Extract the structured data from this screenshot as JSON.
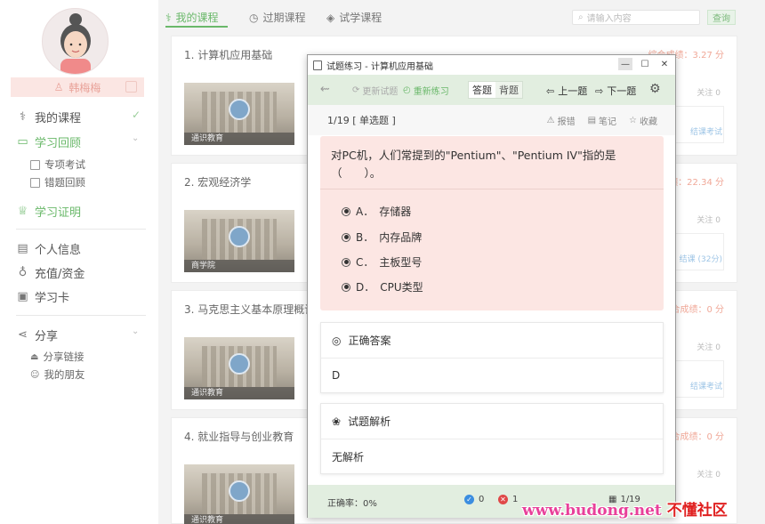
{
  "sidebar": {
    "username": "韩梅梅",
    "nav": [
      {
        "label": "我的课程",
        "icon": "book-icon"
      },
      {
        "label": "学习回顾",
        "icon": "monitor-icon"
      },
      {
        "label": "学习证明",
        "icon": "certificate-icon"
      },
      {
        "label": "个人信息",
        "icon": "id-card-icon"
      },
      {
        "label": "充值/资金",
        "icon": "money-bag-icon"
      },
      {
        "label": "学习卡",
        "icon": "card-icon"
      },
      {
        "label": "分享",
        "icon": "share-icon"
      }
    ],
    "review_sub": [
      "专项考试",
      "错题回顾"
    ],
    "share_sub": [
      "分享链接",
      "我的朋友"
    ]
  },
  "tabs": [
    {
      "label": "我的课程"
    },
    {
      "label": "过期课程"
    },
    {
      "label": "试学课程"
    }
  ],
  "search": {
    "placeholder": "请输入内容",
    "button": "查询"
  },
  "courses": [
    {
      "title": "1. 计算机应用基础",
      "score": "综合成绩：3.27 分",
      "caption": "通识教育",
      "follow": "关注 0",
      "exam": "结课考试"
    },
    {
      "title": "2. 宏观经济学",
      "score": "绩：22.34 分",
      "caption": "商学院",
      "follow": "关注 0",
      "exam": "结课 (32分)"
    },
    {
      "title": "3. 马克思主义基本原理概论",
      "score": "合成绩：0 分",
      "caption": "通识教育",
      "follow": "关注 0",
      "exam": "结课考试"
    },
    {
      "title": "4. 就业指导与创业教育",
      "score": "合成绩：0 分",
      "caption": "通识教育",
      "follow": "关注 0",
      "exam": ""
    }
  ],
  "popup": {
    "title": "试题练习 - 计算机应用基础",
    "toolbar": {
      "update": "更新试题",
      "redo": "重新练习",
      "answer_mode": "答题",
      "memorize_mode": "背题",
      "prev": "上一题",
      "next": "下一题"
    },
    "question_index": "1/19 [ 单选题 ]",
    "tools": [
      "报错",
      "笔记",
      "收藏"
    ],
    "question": "对PC机，人们常提到的\"Pentium\"、\"Pentium IV\"指的是（　　）。",
    "options": [
      {
        "key": "A．",
        "text": "存储器"
      },
      {
        "key": "B．",
        "text": "内存品牌"
      },
      {
        "key": "C．",
        "text": "主板型号"
      },
      {
        "key": "D．",
        "text": "CPU类型"
      }
    ],
    "answer_title": "正确答案",
    "answer": "D",
    "analysis_title": "试题解析",
    "analysis": "无解析",
    "status": {
      "rate": "正确率：0%",
      "correct": "0",
      "wrong": "1",
      "page": "1/19"
    }
  },
  "watermark": {
    "site": "www.budong.net",
    "name": "不懂社区"
  },
  "colors": {
    "accent": "#6ab86a",
    "question_bg": "#fce6e3",
    "toolbar_bg": "#e2eee0",
    "score": "#f0a898"
  }
}
